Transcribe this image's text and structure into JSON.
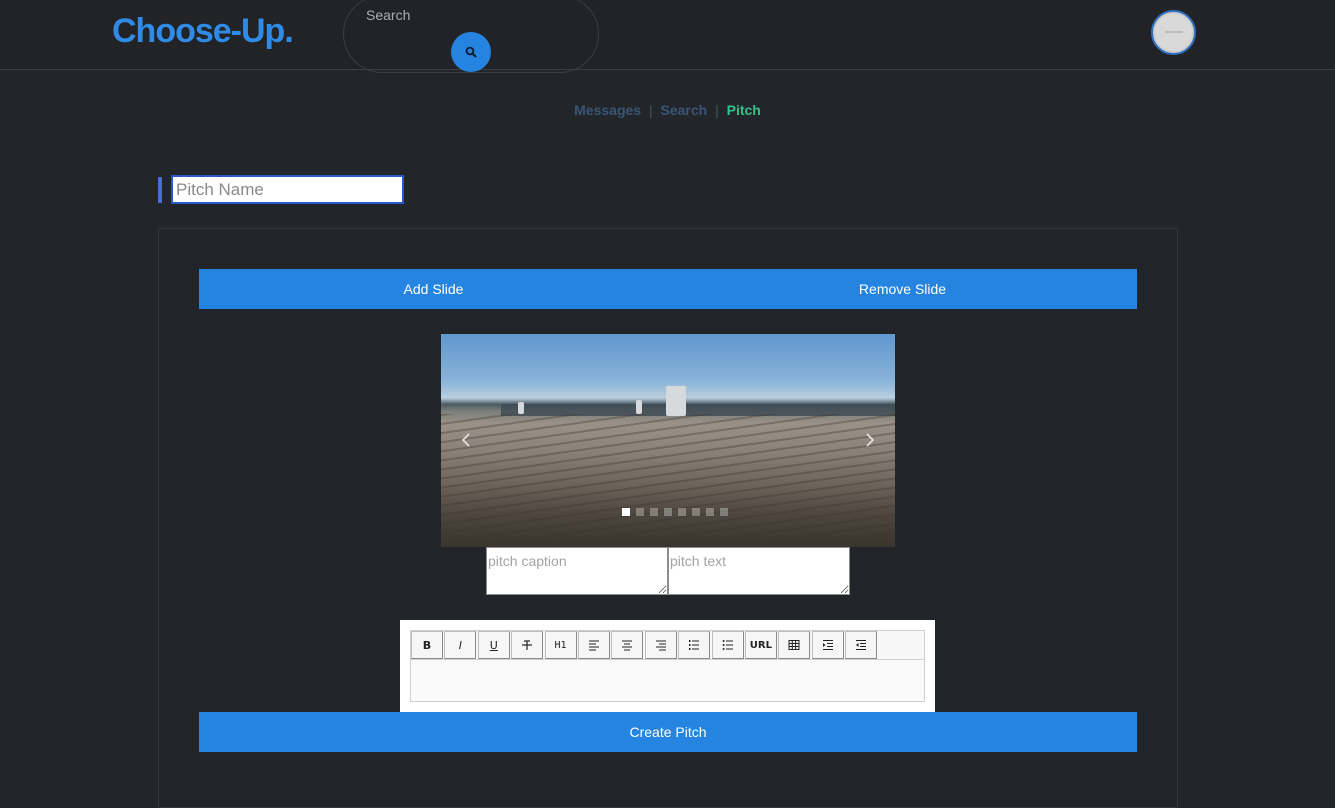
{
  "header": {
    "brand": "Choose-Up.",
    "search_placeholder": "Search",
    "search_icon": "search-icon",
    "avatar_icon": "user-avatar"
  },
  "nav": {
    "items": [
      {
        "label": "Messages",
        "active": false
      },
      {
        "label": "Search",
        "active": false
      },
      {
        "label": "Pitch",
        "active": true
      }
    ]
  },
  "form": {
    "pitch_name_placeholder": "Pitch Name",
    "pitch_name_value": "",
    "add_slide_label": "Add Slide",
    "remove_slide_label": "Remove Slide",
    "carousel": {
      "slide_count": 8,
      "active_slide": 1,
      "prev_icon": "chevron-left-icon",
      "next_icon": "chevron-right-icon"
    },
    "caption_placeholder": "pitch caption",
    "text_placeholder": "pitch text",
    "editor_toolbar": [
      {
        "name": "bold",
        "label": "B"
      },
      {
        "name": "italic",
        "label": "I"
      },
      {
        "name": "underline",
        "label": "U"
      },
      {
        "name": "strikethrough",
        "label": "S"
      },
      {
        "name": "heading",
        "label": "H1"
      },
      {
        "name": "align-left",
        "label": ""
      },
      {
        "name": "align-center",
        "label": ""
      },
      {
        "name": "align-right",
        "label": ""
      },
      {
        "name": "ordered-list",
        "label": ""
      },
      {
        "name": "unordered-list",
        "label": ""
      },
      {
        "name": "link",
        "label": "URL"
      },
      {
        "name": "table",
        "label": ""
      },
      {
        "name": "indent",
        "label": ""
      },
      {
        "name": "outdent",
        "label": ""
      }
    ],
    "create_label": "Create Pitch"
  },
  "colors": {
    "accent": "#2484e0",
    "brand": "#2f8be6",
    "nav_active": "#33c28a",
    "background": "#22262a"
  }
}
